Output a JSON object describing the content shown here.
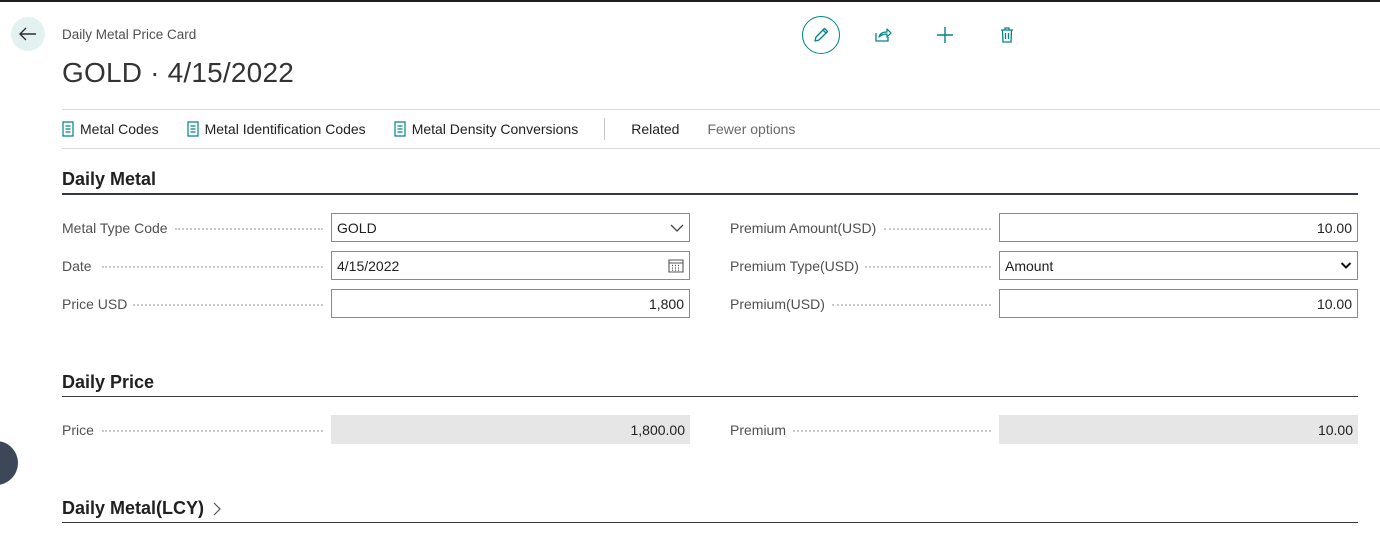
{
  "header": {
    "breadcrumb": "Daily Metal Price Card",
    "title": "GOLD · 4/15/2022"
  },
  "icons": {
    "back": "back-arrow-icon",
    "edit": "pencil-icon",
    "share": "share-icon",
    "new": "plus-icon",
    "delete": "trash-icon"
  },
  "actionbar": {
    "items": [
      "Metal Codes",
      "Metal Identification Codes",
      "Metal Density Conversions"
    ],
    "related": "Related",
    "fewer": "Fewer options"
  },
  "sections": {
    "daily_metal": {
      "title": "Daily Metal",
      "metal_type_code": {
        "label": "Metal Type Code",
        "value": "GOLD"
      },
      "date": {
        "label": "Date",
        "value": "4/15/2022"
      },
      "price_usd": {
        "label": "Price USD",
        "value": "1,800"
      },
      "premium_amount": {
        "label": "Premium Amount(USD)",
        "value": "10.00"
      },
      "premium_type": {
        "label": "Premium Type(USD)",
        "value": "Amount",
        "options": [
          "Amount"
        ]
      },
      "premium_usd": {
        "label": "Premium(USD)",
        "value": "10.00"
      }
    },
    "daily_price": {
      "title": "Daily Price",
      "price": {
        "label": "Price",
        "value": "1,800.00"
      },
      "premium": {
        "label": "Premium",
        "value": "10.00"
      }
    },
    "daily_metal_lcy": {
      "title": "Daily Metal(LCY)"
    }
  },
  "colors": {
    "accent": "#008489",
    "back_bg": "#e3f1f1",
    "readonly_bg": "#e6e6e6"
  }
}
